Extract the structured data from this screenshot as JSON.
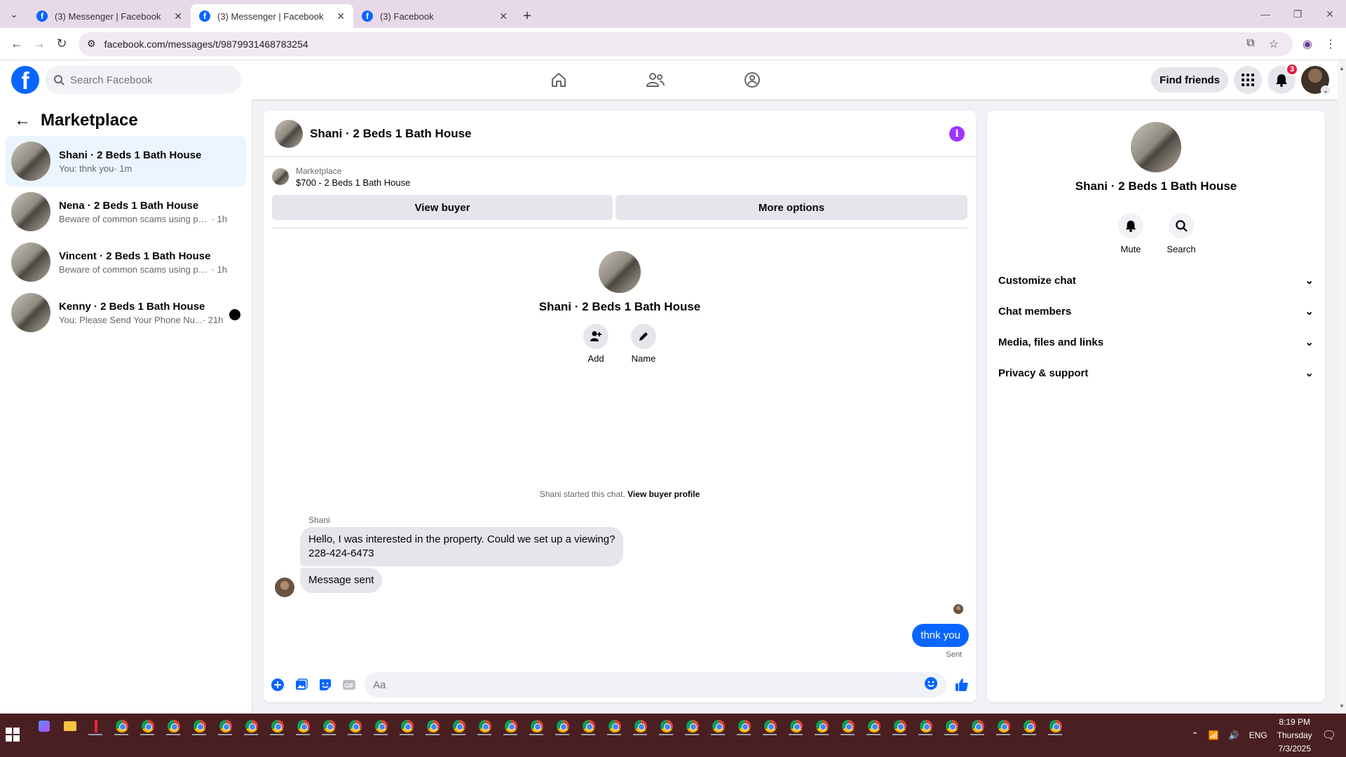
{
  "browser": {
    "tabs": [
      {
        "title": "(3) Messenger | Facebook",
        "active": false
      },
      {
        "title": "(3) Messenger | Facebook",
        "active": true
      },
      {
        "title": "(3) Facebook",
        "active": false
      }
    ],
    "url": "facebook.com/messages/t/9879931468783254"
  },
  "header": {
    "search_placeholder": "Search Facebook",
    "find_friends": "Find friends",
    "notification_count": "3"
  },
  "sidebar": {
    "title": "Marketplace",
    "conversations": [
      {
        "name": "Shani · 2 Beds 1 Bath House",
        "snippet": "You: thnk you",
        "time": " · 1m",
        "selected": true,
        "unread": false
      },
      {
        "name": "Nena · 2 Beds 1 Bath House",
        "snippet": "Beware of common scams using pay...",
        "time": " · 1h",
        "selected": false,
        "unread": false
      },
      {
        "name": "Vincent · 2 Beds 1 Bath House",
        "snippet": "Beware of common scams using pay...",
        "time": " · 1h",
        "selected": false,
        "unread": false
      },
      {
        "name": "Kenny · 2 Beds 1 Bath House",
        "snippet": "You: Please Send Your Phone Nu...",
        "time": " · 21h",
        "selected": false,
        "unread": true
      }
    ]
  },
  "chat": {
    "title": "Shani · 2 Beds 1 Bath House",
    "listing_label": "Marketplace",
    "listing_price": "$700 - 2 Beds 1 Bath House",
    "view_buyer": "View buyer",
    "more_options": "More options",
    "intro_name": "Shani · 2 Beds 1 Bath House",
    "add_label": "Add",
    "name_label": "Name",
    "started_text": "Shani started this chat. ",
    "view_buyer_profile": "View buyer profile",
    "sender": "Shani",
    "messages_in": [
      {
        "line1": "Hello, I was interested in the property. Could we set up a viewing?",
        "line2": "228-424-6473"
      },
      {
        "line1": "Message sent",
        "line2": ""
      }
    ],
    "message_out": "thnk you",
    "status": "Sent",
    "composer_placeholder": "Aa"
  },
  "details": {
    "name": "Shani · 2 Beds 1 Bath House",
    "mute": "Mute",
    "search": "Search",
    "sections": [
      "Customize chat",
      "Chat members",
      "Media, files and links",
      "Privacy & support"
    ]
  },
  "taskbar": {
    "time": "8:19 PM",
    "day": "Thursday",
    "date": "7/3/2025",
    "lang": "ENG"
  },
  "colors": {
    "fb_blue": "#0866ff",
    "selected_bg": "#ebf5ff",
    "taskbar": "#4a1f22",
    "info_purple": "#a033ff"
  }
}
